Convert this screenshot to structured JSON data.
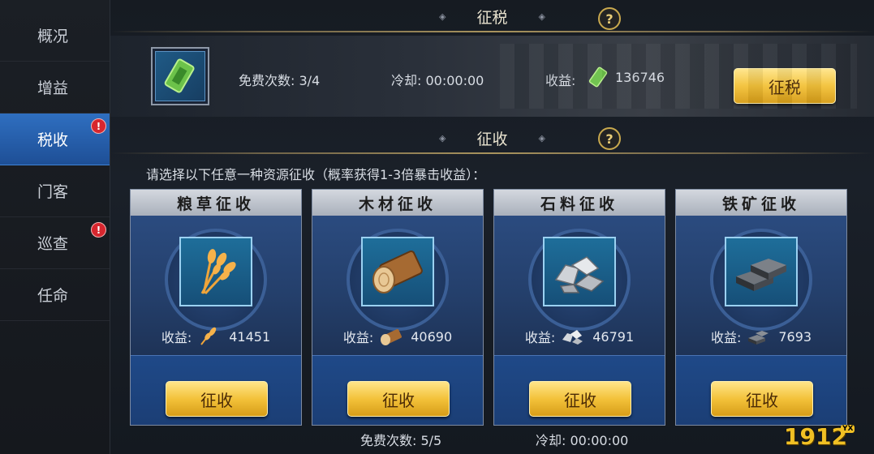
{
  "sidebar": {
    "items": [
      {
        "label": "概况"
      },
      {
        "label": "增益"
      },
      {
        "label": "税收"
      },
      {
        "label": "门客"
      },
      {
        "label": "巡查"
      },
      {
        "label": "任命"
      }
    ],
    "alert_glyph": "!"
  },
  "tax_section": {
    "title": "征税",
    "help": "?",
    "free_count": "免费次数: 3/4",
    "cooldown": "冷却: 00:00:00",
    "yield_label": "收益:",
    "yield_value": "136746",
    "button": "征税"
  },
  "collect_section": {
    "title": "征收",
    "help": "?",
    "instruction": "请选择以下任意一种资源征收（概率获得1-3倍暴击收益）：",
    "cards": [
      {
        "title": "粮草征收",
        "yield_label": "收益:",
        "yield_value": "41451",
        "button": "征收",
        "icon": "wheat-icon"
      },
      {
        "title": "木材征收",
        "yield_label": "收益:",
        "yield_value": "40690",
        "button": "征收",
        "icon": "log-icon"
      },
      {
        "title": "石料征收",
        "yield_label": "收益:",
        "yield_value": "46791",
        "button": "征收",
        "icon": "stone-icon"
      },
      {
        "title": "铁矿征收",
        "yield_label": "收益:",
        "yield_value": "7693",
        "button": "征收",
        "icon": "iron-icon"
      }
    ],
    "free_count": "免费次数: 5/5",
    "cooldown": "冷却: 00:00:00"
  },
  "watermark": {
    "text": "1912",
    "badge": "YX"
  },
  "colors": {
    "accent_blue": "#2f6fc0",
    "button_gold": "#f3c23a",
    "alert_red": "#d7262e"
  }
}
